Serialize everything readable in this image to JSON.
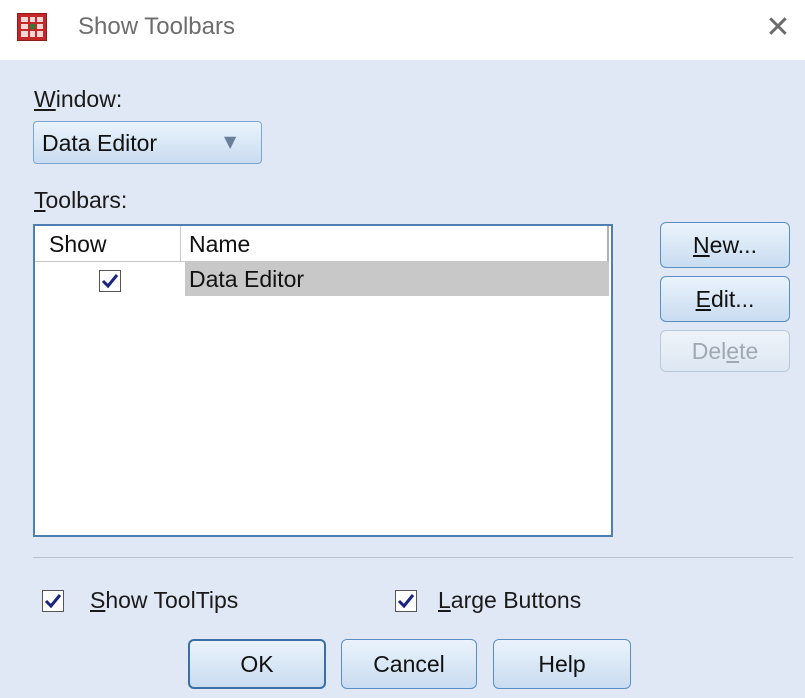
{
  "window": {
    "title": "Show Toolbars",
    "close_glyph": "✕"
  },
  "window_section": {
    "label_accel": "W",
    "label_rest": "indow:",
    "dropdown_value": "Data Editor"
  },
  "toolbars_section": {
    "label_accel": "T",
    "label_rest": "oolbars:",
    "columns": {
      "show": "Show",
      "name": "Name"
    },
    "rows": [
      {
        "show": true,
        "name": "Data Editor"
      }
    ]
  },
  "side_buttons": {
    "new": {
      "accel": "N",
      "rest": "ew..."
    },
    "edit": {
      "accel": "E",
      "rest": "dit..."
    },
    "delete": {
      "pre": "Del",
      "accel": "e",
      "rest": "te"
    }
  },
  "options": {
    "show_tooltips": {
      "checked": true,
      "accel": "S",
      "rest": "how ToolTips"
    },
    "large_buttons": {
      "checked": true,
      "accel": "L",
      "rest": "arge Buttons"
    }
  },
  "footer_buttons": {
    "ok": "OK",
    "cancel": "Cancel",
    "help": "Help"
  },
  "colors": {
    "dialog_bg": "#dfe8f4",
    "accent": "#3a6ea5",
    "check": "#1a237e",
    "app_icon": "#c62828"
  },
  "icons": {
    "app": "spss-data-editor-icon",
    "close": "close-icon",
    "dropdown": "chevron-down-icon",
    "check": "checkmark-icon"
  }
}
